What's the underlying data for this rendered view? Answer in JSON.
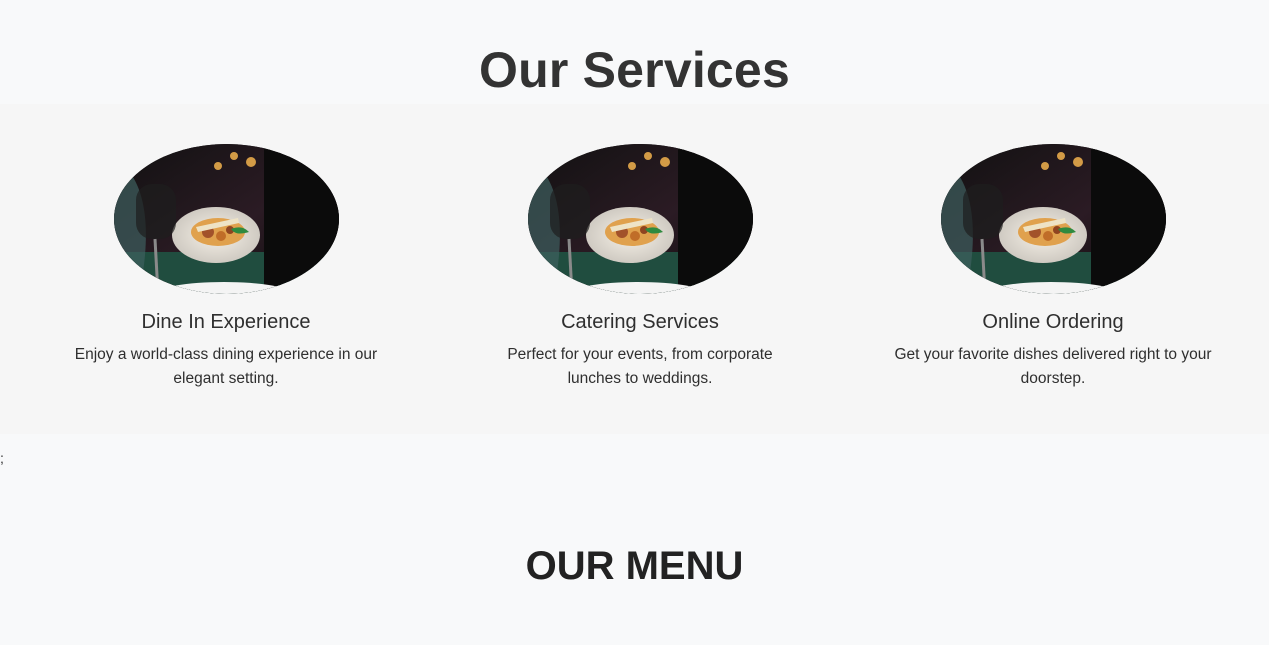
{
  "services": {
    "title": "Our Services",
    "cards": [
      {
        "image_icon": "dish-photo",
        "title": "Dine In Experience",
        "text": "Enjoy a world-class dining experience in our elegant setting."
      },
      {
        "image_icon": "dish-photo",
        "title": "Catering Services",
        "text": "Perfect for your events, from corporate lunches to weddings."
      },
      {
        "image_icon": "dish-photo",
        "title": "Online Ordering",
        "text": "Get your favorite dishes delivered right to your doorstep."
      }
    ]
  },
  "stray_text": ";",
  "menu": {
    "title": "OUR MENU"
  },
  "colors": {
    "background": "#f8f9fa",
    "band": "#f6f6f6",
    "text": "#2f2f2f"
  }
}
